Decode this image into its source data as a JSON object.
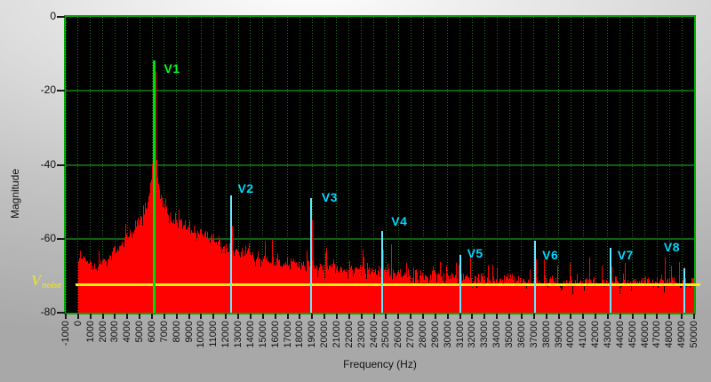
{
  "chart_data": {
    "type": "area",
    "title": "",
    "xlabel": "Frequency (Hz)",
    "ylabel": "Magnitude",
    "xlim": [
      -1000,
      50000
    ],
    "ylim": [
      -80,
      0
    ],
    "x_tick_step_hz": 1000,
    "y_ticks": [
      0,
      -20,
      -40,
      -60,
      -80
    ],
    "grid_h_db": [
      -20,
      -40,
      -60
    ],
    "legend": "none",
    "spectrum": {
      "start_hz": 0,
      "end_hz": 50000,
      "fundamental_hz": 6180,
      "peak_db": -11.8,
      "noise_floor_db": -72.5,
      "envelope_points": [
        [
          0,
          -65
        ],
        [
          700,
          -67
        ],
        [
          1500,
          -68.5
        ],
        [
          2300,
          -65
        ],
        [
          3000,
          -63
        ],
        [
          3800,
          -60.5
        ],
        [
          4400,
          -58
        ],
        [
          5000,
          -55
        ],
        [
          5400,
          -52
        ],
        [
          5700,
          -48.5
        ],
        [
          5900,
          -44
        ],
        [
          6050,
          -38
        ],
        [
          6180,
          -29.5
        ],
        [
          6320,
          -38
        ],
        [
          6450,
          -44
        ],
        [
          6650,
          -48.5
        ],
        [
          6900,
          -51.5
        ],
        [
          7300,
          -54
        ],
        [
          7800,
          -55.5
        ],
        [
          8600,
          -56.5
        ],
        [
          9300,
          -58
        ],
        [
          10300,
          -59.5
        ],
        [
          11000,
          -60.7
        ],
        [
          11700,
          -62
        ],
        [
          12800,
          -63.7
        ],
        [
          14000,
          -65
        ],
        [
          15500,
          -66
        ],
        [
          17000,
          -66.8
        ],
        [
          19000,
          -67.6
        ],
        [
          21000,
          -68.3
        ],
        [
          23000,
          -68.9
        ],
        [
          25000,
          -69.4
        ],
        [
          27500,
          -70
        ],
        [
          30000,
          -70.5
        ],
        [
          33000,
          -71
        ],
        [
          36000,
          -71.3
        ],
        [
          40000,
          -71.7
        ],
        [
          44000,
          -72
        ],
        [
          50000,
          -72.3
        ]
      ],
      "extra_spikes": [
        [
          7900,
          -53
        ],
        [
          8700,
          -55
        ],
        [
          9400,
          -56.5
        ],
        [
          10300,
          -58
        ],
        [
          13800,
          -62.5
        ],
        [
          16200,
          -64
        ],
        [
          20700,
          -65.5
        ],
        [
          25400,
          -61.5
        ],
        [
          26600,
          -66.5
        ],
        [
          28800,
          -67.5
        ],
        [
          33600,
          -67
        ],
        [
          39900,
          -66.5
        ],
        [
          41500,
          -65
        ],
        [
          44400,
          -66.5
        ],
        [
          47600,
          -65
        ],
        [
          48800,
          -66.3
        ]
      ],
      "seed": 987654321,
      "jitter_db": 3,
      "spike_prob": 0.09,
      "spike_extra_db": 5.5,
      "dip_prob": 0.22,
      "dip_db": 2.2
    },
    "cursors": {
      "harmonics": [
        {
          "label": "V1",
          "freq_hz": 6180,
          "marker_top_db": -11.8,
          "label_top_db": -12.3,
          "label_dx": 11,
          "spike_db": -11.8,
          "color_role": "fundamental"
        },
        {
          "label": "V2",
          "freq_hz": 12450,
          "marker_top_db": -48.4,
          "label_top_db": -44.6,
          "label_dx": 7,
          "spike_db": -53.5,
          "color_role": "harmonic"
        },
        {
          "label": "V3",
          "freq_hz": 18900,
          "marker_top_db": -48.9,
          "label_top_db": -47.0,
          "label_dx": 12,
          "spike_db": -52,
          "color_role": "harmonic"
        },
        {
          "label": "V4",
          "freq_hz": 24700,
          "marker_top_db": -58.0,
          "label_top_db": -53.6,
          "label_dx": 10,
          "spike_db": -60,
          "color_role": "harmonic"
        },
        {
          "label": "V5",
          "freq_hz": 31000,
          "marker_top_db": -64.4,
          "label_top_db": -62.2,
          "label_dx": 8,
          "spike_db": -66.5,
          "color_role": "harmonic"
        },
        {
          "label": "V6",
          "freq_hz": 37100,
          "marker_top_db": -60.6,
          "label_top_db": -62.7,
          "label_dx": 8,
          "spike_db": -62.5,
          "color_role": "harmonic"
        },
        {
          "label": "V7",
          "freq_hz": 43200,
          "marker_top_db": -62.5,
          "label_top_db": -62.7,
          "label_dx": 8,
          "spike_db": -64.5,
          "color_role": "harmonic"
        },
        {
          "label": "V8",
          "freq_hz": 49200,
          "marker_top_db": -68.0,
          "label_top_db": -60.5,
          "label_dx": -23,
          "spike_db": -67.7,
          "color_role": "harmonic"
        }
      ],
      "noise": {
        "label_main": "V",
        "label_sub": "noise",
        "value_db": -72.5
      }
    },
    "colors": {
      "plot_bg": "#000000",
      "trace": "#fe0202",
      "grid_dotted": "#1e7a1e",
      "grid_solid": "#0c620c",
      "plot_border": "#00ae00",
      "fundamental_line": "#00dc00",
      "fundamental_text": "#00ff22",
      "harmonic_line": "#63e9ff",
      "harmonic_text": "#00d7ff",
      "noise_line": "#ffee00",
      "noise_text": "#e3da45",
      "tick_text": "#111111"
    }
  }
}
